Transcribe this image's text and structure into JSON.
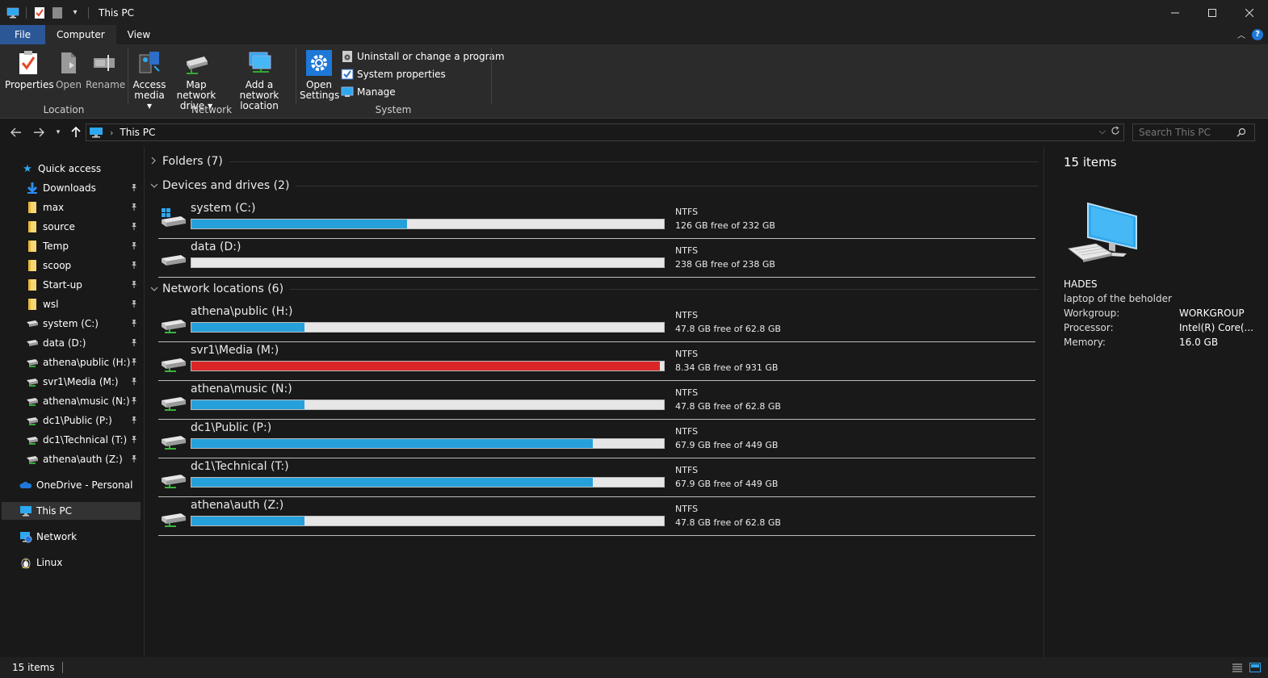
{
  "window": {
    "title": "This PC"
  },
  "ribbon_tabs": [
    "File",
    "Computer",
    "View"
  ],
  "ribbon": {
    "location": {
      "label": "Location",
      "properties": "Properties",
      "open": "Open",
      "rename": "Rename"
    },
    "network": {
      "label": "Network",
      "access_media": [
        "Access",
        "media"
      ],
      "map_drive": [
        "Map network",
        "drive"
      ],
      "add_location": [
        "Add a network",
        "location"
      ]
    },
    "system": {
      "label": "System",
      "open_settings": [
        "Open",
        "Settings"
      ],
      "uninstall": "Uninstall or change a program",
      "sys_props": "System properties",
      "manage": "Manage"
    }
  },
  "address": {
    "crumb": "This PC"
  },
  "search": {
    "placeholder": "Search This PC"
  },
  "nav": {
    "quick_access": "Quick access",
    "pinned": [
      "Downloads",
      "max",
      "source",
      "Temp",
      "scoop",
      "Start-up",
      "wsl",
      "system (C:)",
      "data (D:)",
      "athena\\public (H:)",
      "svr1\\Media (M:)",
      "athena\\music (N:)",
      "dc1\\Public (P:)",
      "dc1\\Technical (T:)",
      "athena\\auth (Z:)"
    ],
    "onedrive": "OneDrive - Personal",
    "this_pc": "This PC",
    "network": "Network",
    "linux": "Linux"
  },
  "groups": {
    "folders": "Folders (7)",
    "devices": "Devices and drives (2)",
    "network": "Network locations (6)"
  },
  "devices": [
    {
      "name": "system (C:)",
      "fs": "NTFS",
      "free_text": "126 GB free of 232 GB",
      "used_fraction": 0.457,
      "icon": "windows-drive-icon"
    },
    {
      "name": "data (D:)",
      "fs": "NTFS",
      "free_text": "238 GB free of 238 GB",
      "used_fraction": 0.0,
      "icon": "drive-icon"
    }
  ],
  "network_locations": [
    {
      "name": "athena\\public (H:)",
      "fs": "NTFS",
      "free_text": "47.8 GB free of 62.8 GB",
      "used_fraction": 0.239
    },
    {
      "name": "svr1\\Media (M:)",
      "fs": "NTFS",
      "free_text": "8.34 GB free of 931 GB",
      "used_fraction": 0.991
    },
    {
      "name": "athena\\music (N:)",
      "fs": "NTFS",
      "free_text": "47.8 GB free of 62.8 GB",
      "used_fraction": 0.239
    },
    {
      "name": "dc1\\Public (P:)",
      "fs": "NTFS",
      "free_text": "67.9 GB free of 449 GB",
      "used_fraction": 0.849
    },
    {
      "name": "dc1\\Technical (T:)",
      "fs": "NTFS",
      "free_text": "67.9 GB free of 449 GB",
      "used_fraction": 0.849
    },
    {
      "name": "athena\\auth (Z:)",
      "fs": "NTFS",
      "free_text": "47.8 GB free of 62.8 GB",
      "used_fraction": 0.239
    }
  ],
  "details": {
    "count": "15 items",
    "name": "HADES",
    "description": "laptop of the beholder",
    "props": [
      {
        "label": "Workgroup:",
        "value": "WORKGROUP"
      },
      {
        "label": "Processor:",
        "value": "Intel(R) Core(..."
      },
      {
        "label": "Memory:",
        "value": "16.0 GB"
      }
    ]
  },
  "status": {
    "count": "15 items"
  },
  "colors": {
    "accent": "#26a0da",
    "full_drive": "#da2626",
    "file_tab": "#2b5797"
  }
}
